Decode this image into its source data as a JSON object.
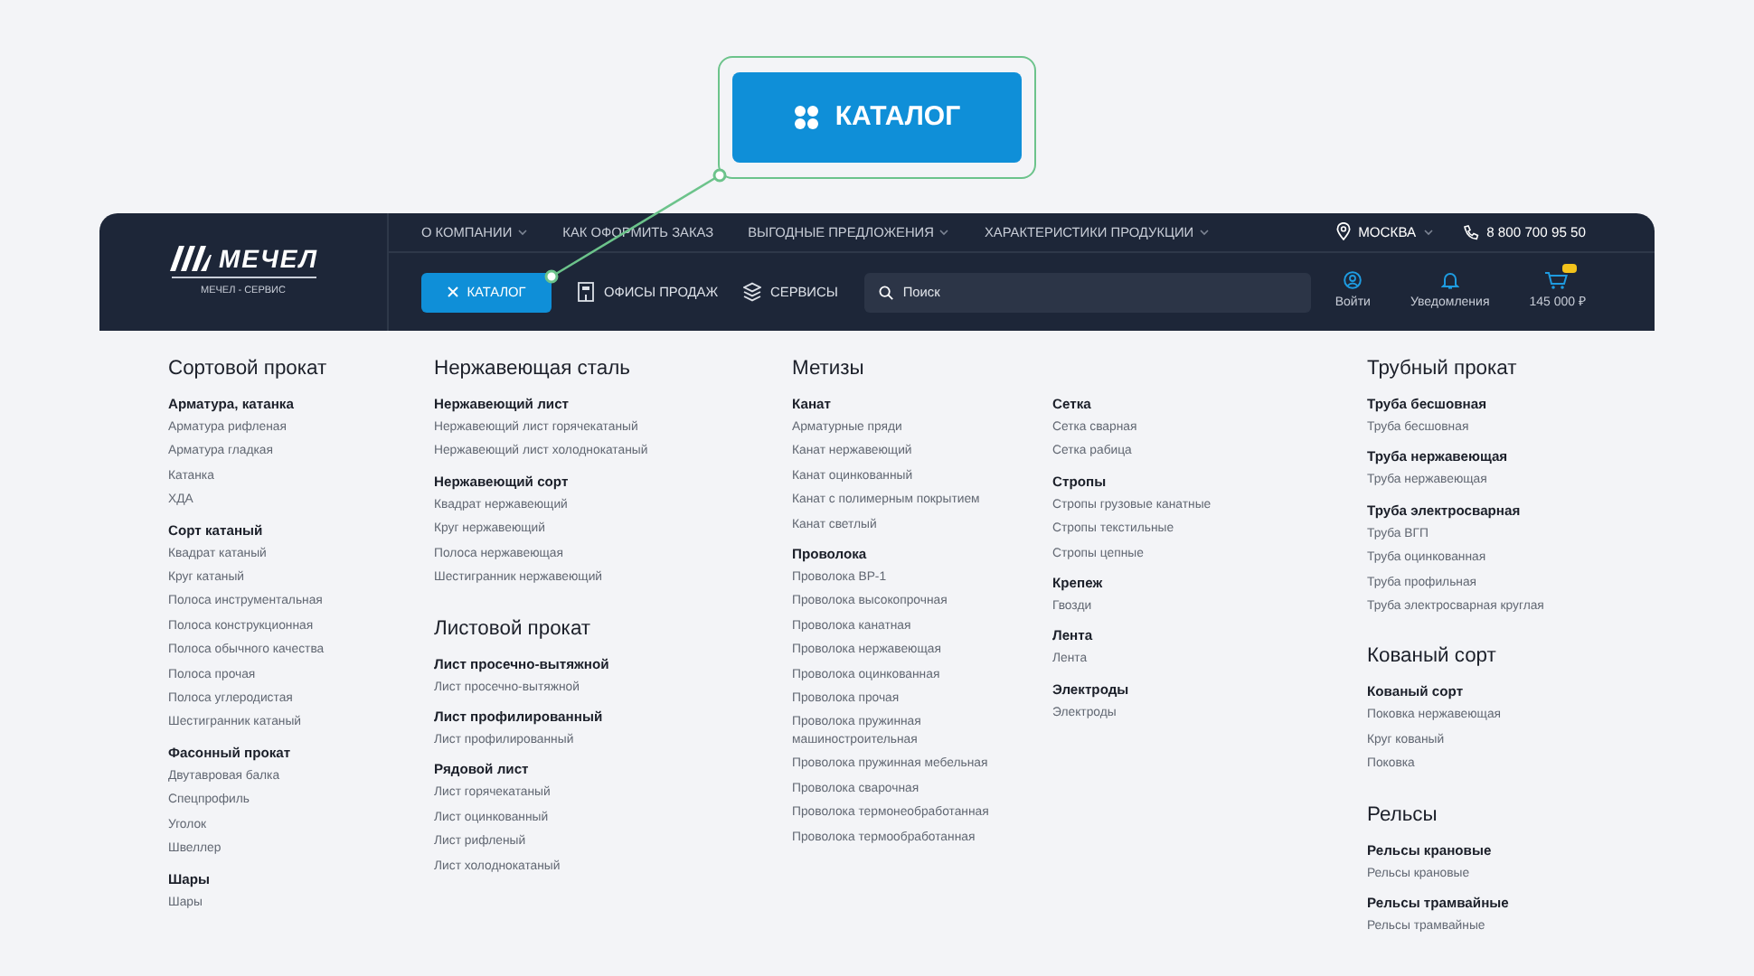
{
  "callout": {
    "label": "КАТАЛОГ"
  },
  "header": {
    "logo": {
      "brand": "МЕЧЕЛ",
      "subtitle": "МЕЧЕЛ - СЕРВИС"
    },
    "top_nav": [
      {
        "label": "О КОМПАНИИ",
        "dropdown": true
      },
      {
        "label": "КАК ОФОРМИТЬ ЗАКАЗ",
        "dropdown": false
      },
      {
        "label": "ВЫГОДНЫЕ ПРЕДЛОЖЕНИЯ",
        "dropdown": true
      },
      {
        "label": "ХАРАКТЕРИСТИКИ ПРОДУКЦИИ",
        "dropdown": true
      }
    ],
    "city": {
      "label": "МОСКВА"
    },
    "phone": "8 800 700 95 50",
    "catalog_button": {
      "label": "КАТАЛОГ",
      "expanded": true
    },
    "tools": [
      {
        "label": "ОФИСЫ ПРОДАЖ",
        "kind": "offices"
      },
      {
        "label": "СЕРВИСЫ",
        "kind": "services"
      }
    ],
    "search": {
      "placeholder": "Поиск"
    },
    "actions": [
      {
        "label": "Войти",
        "kind": "user"
      },
      {
        "label": "Уведомления",
        "kind": "bell"
      },
      {
        "label": "145 000 ₽",
        "kind": "cart"
      }
    ]
  },
  "catalog": {
    "columns": [
      {
        "sections": [
          {
            "title": "Сортовой прокат",
            "groups": [
              {
                "title": "Арматура, катанка",
                "items": [
                  "Арматура рифленая",
                  "Арматура гладкая",
                  "Катанка",
                  "ХДА"
                ]
              },
              {
                "title": "Сорт катаный",
                "items": [
                  "Квадрат катаный",
                  "Круг катаный",
                  "Полоса инструментальная",
                  "Полоса конструкционная",
                  "Полоса обычного качества",
                  "Полоса прочая",
                  "Полоса углеродистая",
                  "Шестигранник катаный"
                ]
              },
              {
                "title": "Фасонный прокат",
                "items": [
                  "Двутавровая балка",
                  "Спецпрофиль",
                  "Уголок",
                  "Швеллер"
                ]
              },
              {
                "title": "Шары",
                "items": [
                  "Шары"
                ]
              }
            ]
          }
        ]
      },
      {
        "sections": [
          {
            "title": "Нержавеющая сталь",
            "groups": [
              {
                "title": "Нержавеющий лист",
                "items": [
                  "Нержавеющий лист горячекатаный",
                  "Нержавеющий лист холоднокатаный"
                ]
              },
              {
                "title": "Нержавеющий сорт",
                "items": [
                  "Квадрат нержавеющий",
                  "Круг нержавеющий",
                  "Полоса нержавеющая",
                  "Шестигранник нержавеющий"
                ]
              }
            ]
          },
          {
            "title": "Листовой прокат",
            "groups": [
              {
                "title": "Лист просечно-вытяжной",
                "items": [
                  "Лист просечно-вытяжной"
                ]
              },
              {
                "title": "Лист профилированный",
                "items": [
                  "Лист профилированный"
                ]
              },
              {
                "title": "Рядовой лист",
                "items": [
                  "Лист горячекатаный",
                  "Лист оцинкованный",
                  "Лист рифленый",
                  "Лист холоднокатаный"
                ]
              }
            ]
          }
        ]
      },
      {
        "sections": [
          {
            "title": "Метизы",
            "groups": [
              {
                "title": "Канат",
                "items": [
                  "Арматурные пряди",
                  "Канат нержавеющий",
                  "Канат оцинкованный",
                  "Канат с полимерным покрытием",
                  "Канат светлый"
                ]
              },
              {
                "title": "Проволока",
                "items": [
                  "Проволока ВР-1",
                  "Проволока высокопрочная",
                  "Проволока канатная",
                  "Проволока нержавеющая",
                  "Проволока оцинкованная",
                  "Проволока прочая",
                  "Проволока пружинная машиностроительная",
                  "Проволока пружинная мебельная",
                  "Проволока сварочная",
                  "Проволока термонеобработанная",
                  "Проволока термообработанная"
                ]
              }
            ]
          }
        ]
      },
      {
        "sections": [
          {
            "groups": [
              {
                "title": "Сетка",
                "items": [
                  "Сетка сварная",
                  "Сетка рабица"
                ]
              },
              {
                "title": "Стропы",
                "items": [
                  "Стропы грузовые канатные",
                  "Стропы текстильные",
                  "Стропы цепные"
                ]
              },
              {
                "title": "Крепеж",
                "items": [
                  "Гвозди"
                ]
              },
              {
                "title": "Лента",
                "items": [
                  "Лента"
                ]
              },
              {
                "title": "Электроды",
                "items": [
                  "Электроды"
                ]
              }
            ]
          }
        ]
      },
      {
        "sections": [
          {
            "title": "Трубный прокат",
            "groups": [
              {
                "title": "Труба бесшовная",
                "items": [
                  "Труба бесшовная"
                ]
              },
              {
                "title": "Труба нержавеющая",
                "items": [
                  "Труба нержавеющая"
                ]
              },
              {
                "title": "Труба электросварная",
                "items": [
                  "Труба ВГП",
                  "Труба оцинкованная",
                  "Труба профильная",
                  "Труба электросварная круглая"
                ]
              }
            ]
          },
          {
            "title": "Кованый сорт",
            "groups": [
              {
                "title": "Кованый сорт",
                "items": [
                  "Поковка нержавеющая",
                  "Круг кованый",
                  "Поковка"
                ]
              }
            ]
          },
          {
            "title": "Рельсы",
            "groups": [
              {
                "title": "Рельсы крановые",
                "items": [
                  "Рельсы крановые"
                ]
              },
              {
                "title": "Рельсы трамвайные",
                "items": [
                  "Рельсы трамвайные"
                ]
              }
            ]
          }
        ]
      }
    ]
  }
}
